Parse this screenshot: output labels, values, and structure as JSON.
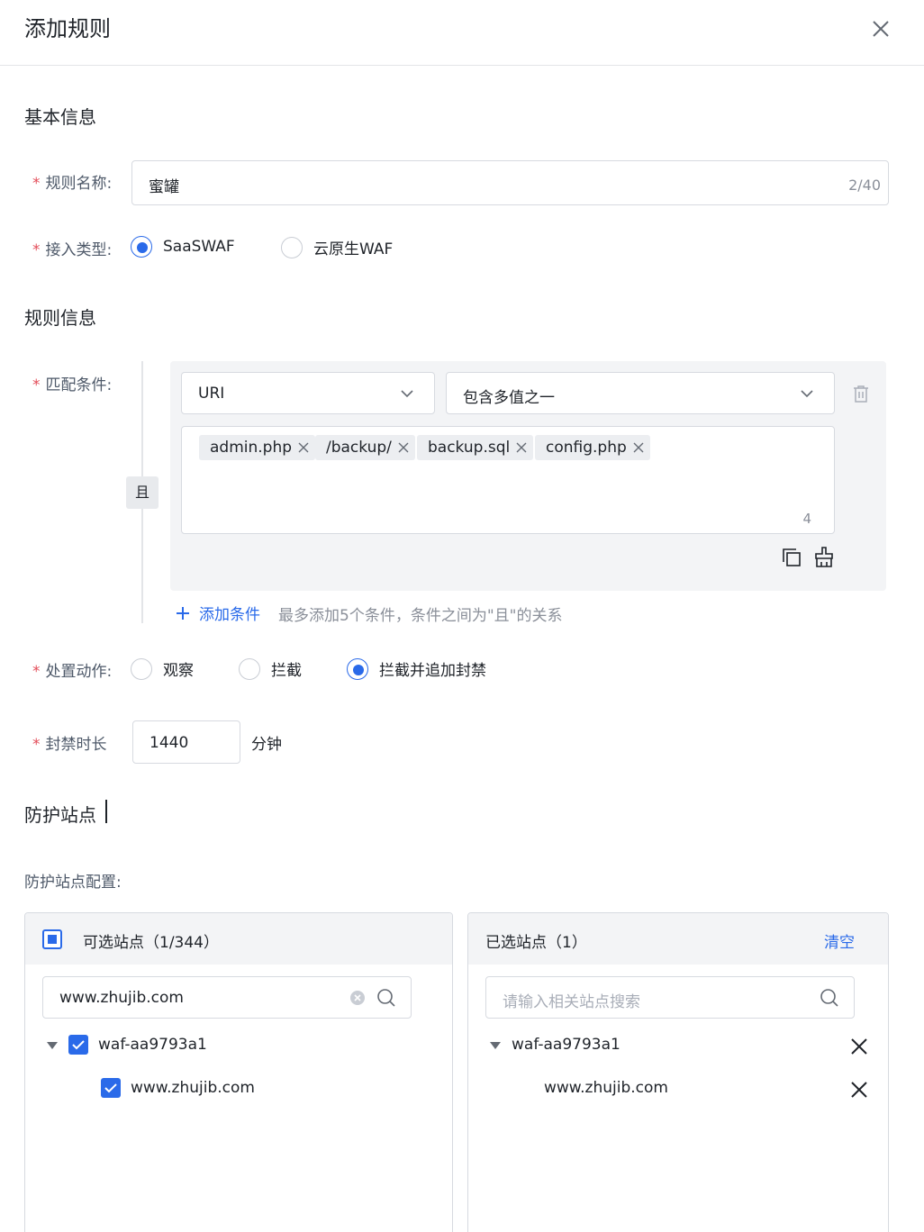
{
  "header": {
    "title": "添加规则"
  },
  "basic": {
    "section_title": "基本信息",
    "name_label": "规则名称:",
    "name_value": "蜜罐",
    "name_count": "2/40",
    "type_label": "接入类型:",
    "type_options": [
      "SaaSWAF",
      "云原生WAF"
    ],
    "type_selected": "SaaSWAF"
  },
  "rule": {
    "section_title": "规则信息",
    "match_label": "匹配条件:",
    "and_label": "且",
    "field_select": "URI",
    "operator_select": "包含多值之一",
    "values": [
      "admin.php",
      "/backup/",
      "backup.sql",
      "config.php"
    ],
    "values_count": "4",
    "add_condition": "添加条件",
    "add_tip": "最多添加5个条件，条件之间为\"且\"的关系",
    "action_label": "处置动作:",
    "action_options": [
      "观察",
      "拦截",
      "拦截并追加封禁"
    ],
    "action_selected": "拦截并追加封禁",
    "ban_label": "封禁时长",
    "ban_value": "1440",
    "ban_unit": "分钟"
  },
  "sites": {
    "section_title": "防护站点",
    "config_label": "防护站点配置:",
    "available": {
      "title": "可选站点（1/344）",
      "search_value": "www.zhujib.com",
      "group": "waf-aa9793a1",
      "item": "www.zhujib.com"
    },
    "selected": {
      "title": "已选站点（1）",
      "clear": "清空",
      "search_placeholder": "请输入相关站点搜索",
      "group": "waf-aa9793a1",
      "item": "www.zhujib.com"
    }
  }
}
